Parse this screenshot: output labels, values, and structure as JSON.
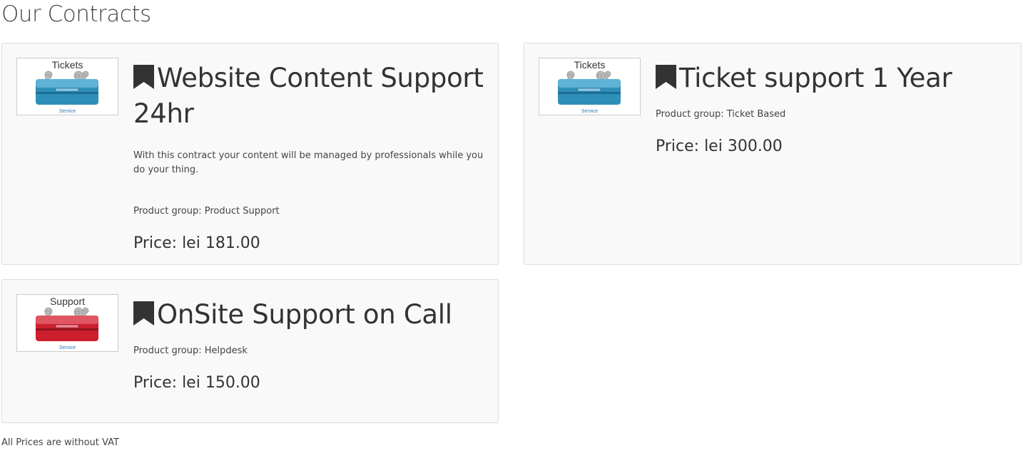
{
  "page": {
    "title": "Our Contracts",
    "footnote": "All Prices are without VAT"
  },
  "products": [
    {
      "thumb_title": "Tickets",
      "thumb_caption": "Service",
      "thumb_color": "#2e8fb8",
      "title": "Website Content Support 24hr",
      "description": "With this contract your content will be managed by professionals while you do your thing.",
      "group": "Product group: Product Support",
      "price": "Price: lei 181.00",
      "icon": "bookmark-icon"
    },
    {
      "thumb_title": "Tickets",
      "thumb_caption": "Service",
      "thumb_color": "#2e8fb8",
      "title": "Ticket support 1 Year",
      "group": "Product group: Ticket Based",
      "price": "Price: lei 300.00",
      "icon": "bookmark-icon"
    },
    {
      "thumb_title": "Support",
      "thumb_caption": "Service",
      "thumb_color": "#cc1f2e",
      "title": "OnSite Support on Call",
      "group": "Product group: Helpdesk",
      "price": "Price: lei 150.00",
      "icon": "bookmark-icon"
    }
  ]
}
